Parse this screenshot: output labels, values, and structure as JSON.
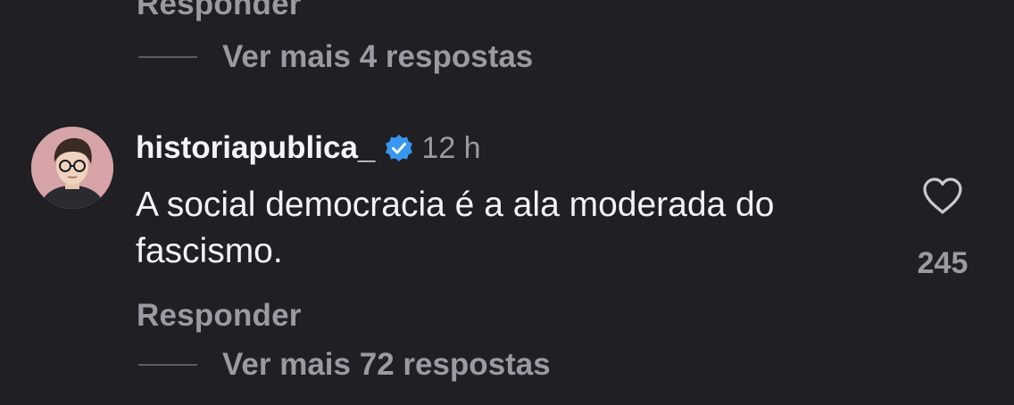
{
  "prev_comment": {
    "reply_label": "Responder",
    "more_replies_label": "Ver mais 4 respostas"
  },
  "comment": {
    "username": "historiapublica_",
    "verified": true,
    "time": "12 h",
    "text": "A social democracia é a ala moderada do fascismo.",
    "likes": "245",
    "reply_label": "Responder",
    "more_replies_label": "Ver mais 72 respostas"
  },
  "icons": {
    "verified": "verified-badge-icon",
    "like": "heart-outline-icon"
  },
  "colors": {
    "background": "#1f1f24",
    "primary_text": "#f2f2f4",
    "secondary_text": "#9a9aa2",
    "verified_blue": "#3897f0"
  }
}
